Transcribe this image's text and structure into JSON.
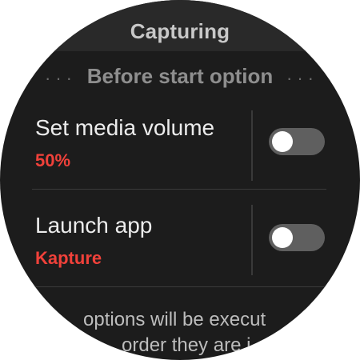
{
  "header": {
    "title": "Capturing"
  },
  "section": {
    "title": "Before start option",
    "dots": "···"
  },
  "options": [
    {
      "title": "Set media volume",
      "value": "50%",
      "enabled": false
    },
    {
      "title": "Launch app",
      "value": "Kapture",
      "enabled": false
    }
  ],
  "footer": {
    "line1": "options will be execut",
    "line2": "order they are i"
  },
  "colors": {
    "background": "#1c1c1c",
    "header": "#292929",
    "accent": "#f0413a",
    "toggle_off": "#5f5f5f"
  }
}
